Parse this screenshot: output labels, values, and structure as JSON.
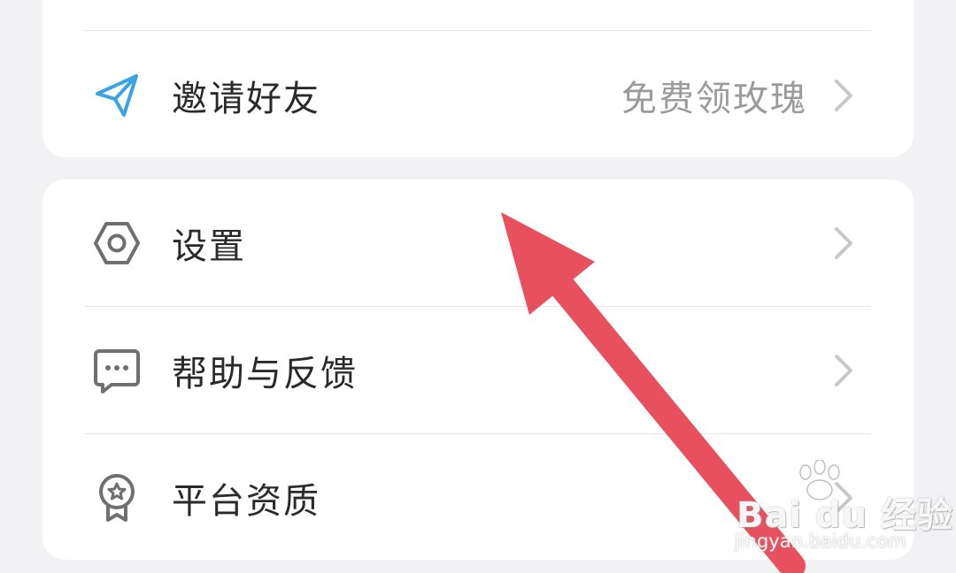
{
  "menu_top": {
    "items": [
      {
        "label": "邀请好友",
        "hint": "免费领玫瑰",
        "icon": "paper-plane-icon"
      }
    ]
  },
  "menu_bottom": {
    "items": [
      {
        "label": "设置",
        "icon": "settings-hexagon-icon"
      },
      {
        "label": "帮助与反馈",
        "icon": "chat-bubble-icon"
      },
      {
        "label": "平台资质",
        "icon": "award-badge-icon"
      }
    ]
  },
  "annotation": {
    "icon": "red-pointer-arrow",
    "color": "#e8505e"
  },
  "watermark": {
    "brand": "Bai du 经验",
    "url": "jingyan.baidu.com"
  },
  "colors": {
    "background": "#f2f2f4",
    "card": "#ffffff",
    "accent_blue": "#3aa3e3",
    "text": "#2a2a2a",
    "hint": "#9b9b9b"
  }
}
